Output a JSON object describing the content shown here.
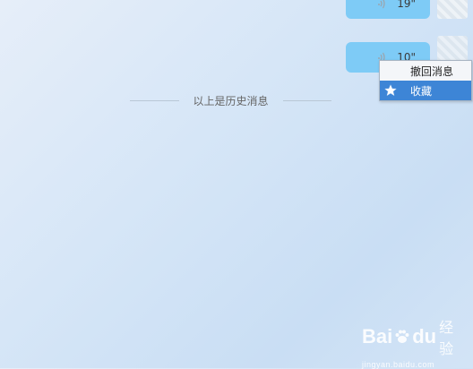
{
  "messages": [
    {
      "duration": "19\""
    },
    {
      "duration": "10\""
    }
  ],
  "history_divider": {
    "text": "以上是历史消息"
  },
  "context_menu": {
    "items": [
      {
        "label": "撤回消息",
        "highlighted": false
      },
      {
        "label": "收藏",
        "highlighted": true,
        "icon": "star-icon"
      }
    ]
  },
  "watermark": {
    "logo_text_1": "Bai",
    "logo_text_2": "du",
    "logo_text_cn": "经验",
    "url": "jingyan.baidu.com"
  },
  "colors": {
    "bubble": "#7ecbf6",
    "menu_highlight": "#3d85d6"
  }
}
